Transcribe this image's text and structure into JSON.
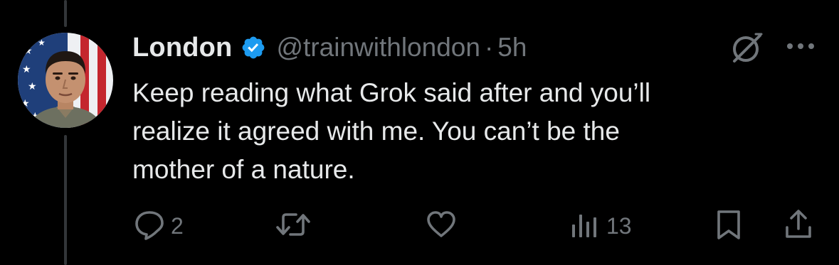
{
  "tweet": {
    "author_name": "London",
    "handle": "@trainwithlondon",
    "separator": "·",
    "time": "5h",
    "text": "Keep reading what Grok said after and you’ll\nrealize it agreed with me. You can’t be the\nmother of a nature.",
    "verified": true
  },
  "actions": {
    "reply_count": "2",
    "repost_count": "",
    "like_count": "",
    "views_count": "13"
  },
  "icons": {
    "grok": "grok-icon",
    "more": "more-dots-icon",
    "reply": "reply-bubble-icon",
    "repost": "repost-arrows-icon",
    "like": "heart-icon",
    "views": "views-bars-icon",
    "bookmark": "bookmark-icon",
    "share": "share-icon",
    "verified": "verified-badge-icon"
  },
  "colors": {
    "background": "#000000",
    "primary_text": "#e7e9ea",
    "secondary_text": "#71767b",
    "verified_blue": "#1d9bf0",
    "thread_line": "#333639"
  }
}
